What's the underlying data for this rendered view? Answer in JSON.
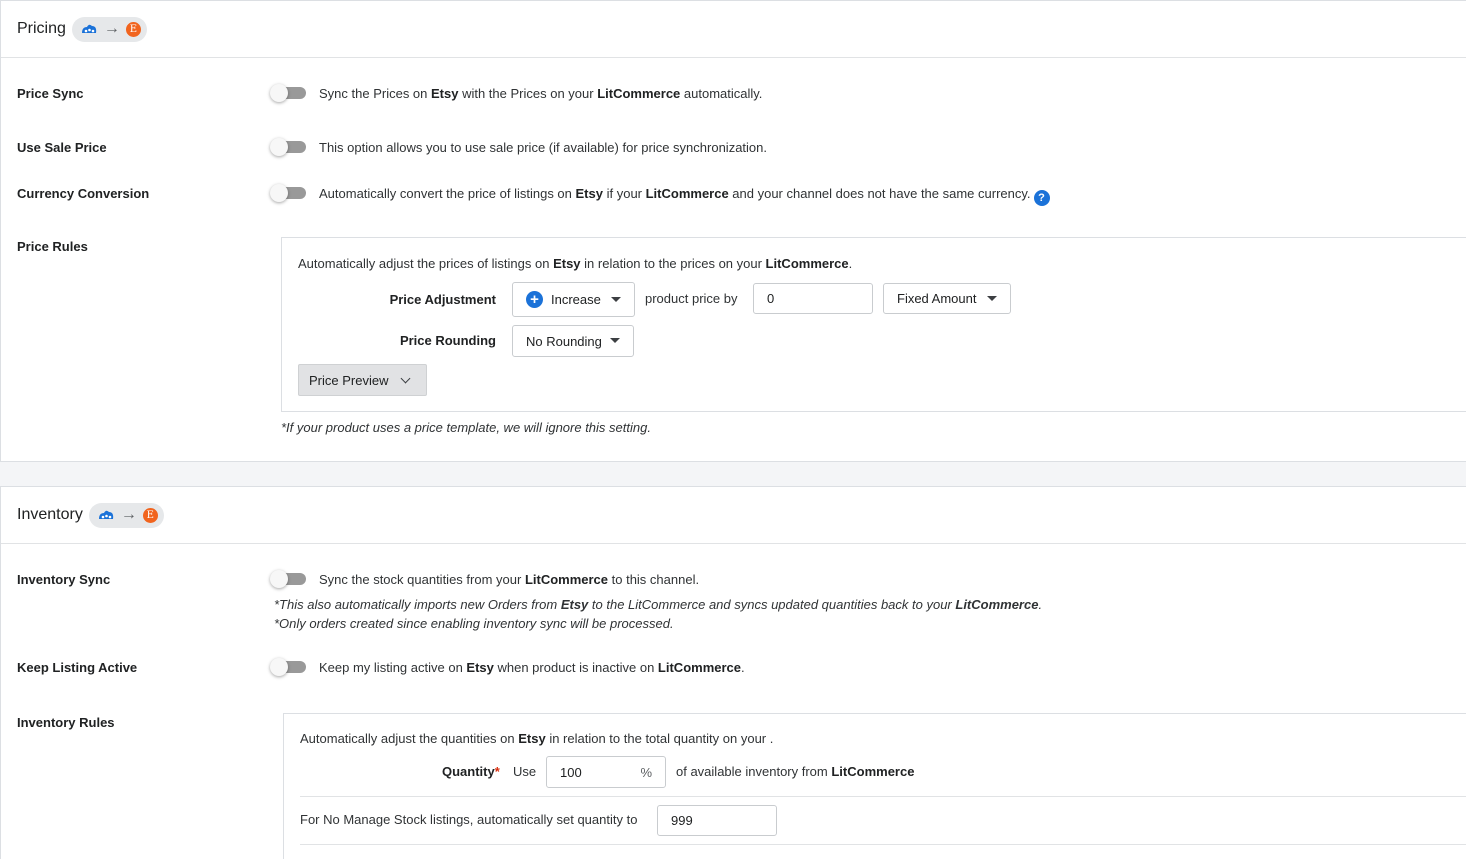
{
  "pricing": {
    "title": "Pricing",
    "price_sync": {
      "label": "Price Sync",
      "desc_parts": [
        "Sync the Prices on ",
        "Etsy",
        " with the Prices on your ",
        "LitCommerce",
        " automatically."
      ]
    },
    "use_sale_price": {
      "label": "Use Sale Price",
      "desc": "This option allows you to use sale price (if available) for price synchronization."
    },
    "currency_conversion": {
      "label": "Currency Conversion",
      "desc_parts": [
        "Automatically convert the price of listings on ",
        "Etsy",
        " if your ",
        "LitCommerce",
        " and your channel does not have the same currency."
      ],
      "help_glyph": "?"
    },
    "price_rules": {
      "label": "Price Rules",
      "intro_parts": [
        "Automatically adjust the prices of listings on ",
        "Etsy",
        " in relation to the prices on your ",
        "LitCommerce",
        "."
      ],
      "adjustment_label": "Price Adjustment",
      "adjustment_value": "Increase",
      "product_price_by": "product price by",
      "amount_value": "0",
      "amount_type": "Fixed Amount",
      "rounding_label": "Price Rounding",
      "rounding_value": "No Rounding",
      "preview_button": "Price Preview",
      "footnote": "*If your product uses a price template, we will ignore this setting."
    }
  },
  "inventory": {
    "title": "Inventory",
    "inventory_sync": {
      "label": "Inventory Sync",
      "desc_parts": [
        "Sync the stock quantities from your ",
        "LitCommerce",
        " to this channel."
      ],
      "note1_parts": [
        "*This also automatically imports new Orders from ",
        "Etsy",
        " to the LitCommerce and syncs updated quantities back to your ",
        "LitCommerce",
        "."
      ],
      "note2": "*Only orders created since enabling inventory sync will be processed."
    },
    "keep_listing_active": {
      "label": "Keep Listing Active",
      "desc_parts": [
        "Keep my listing active on ",
        "Etsy",
        " when product is inactive on ",
        "LitCommerce",
        "."
      ]
    },
    "inventory_rules": {
      "label": "Inventory Rules",
      "intro_parts": [
        "Automatically adjust the quantities on ",
        "Etsy",
        " in relation to the total quantity on your ."
      ],
      "quantity_label": "Quantity",
      "required_mark": "*",
      "use_label": "Use",
      "quantity_value": "100",
      "percent_sign": "%",
      "available_parts": [
        "of available inventory from ",
        "LitCommerce"
      ],
      "no_manage_label": "For No Manage Stock listings, automatically set quantity to",
      "no_manage_value": "999"
    }
  },
  "icons": {
    "source": "litcommerce-icon",
    "arrow": "→",
    "target_letter": "E"
  },
  "colors": {
    "accent": "#1b72d8",
    "etsy": "#f1641e",
    "required": "#d82c0d",
    "toggle_off": "#999999"
  }
}
